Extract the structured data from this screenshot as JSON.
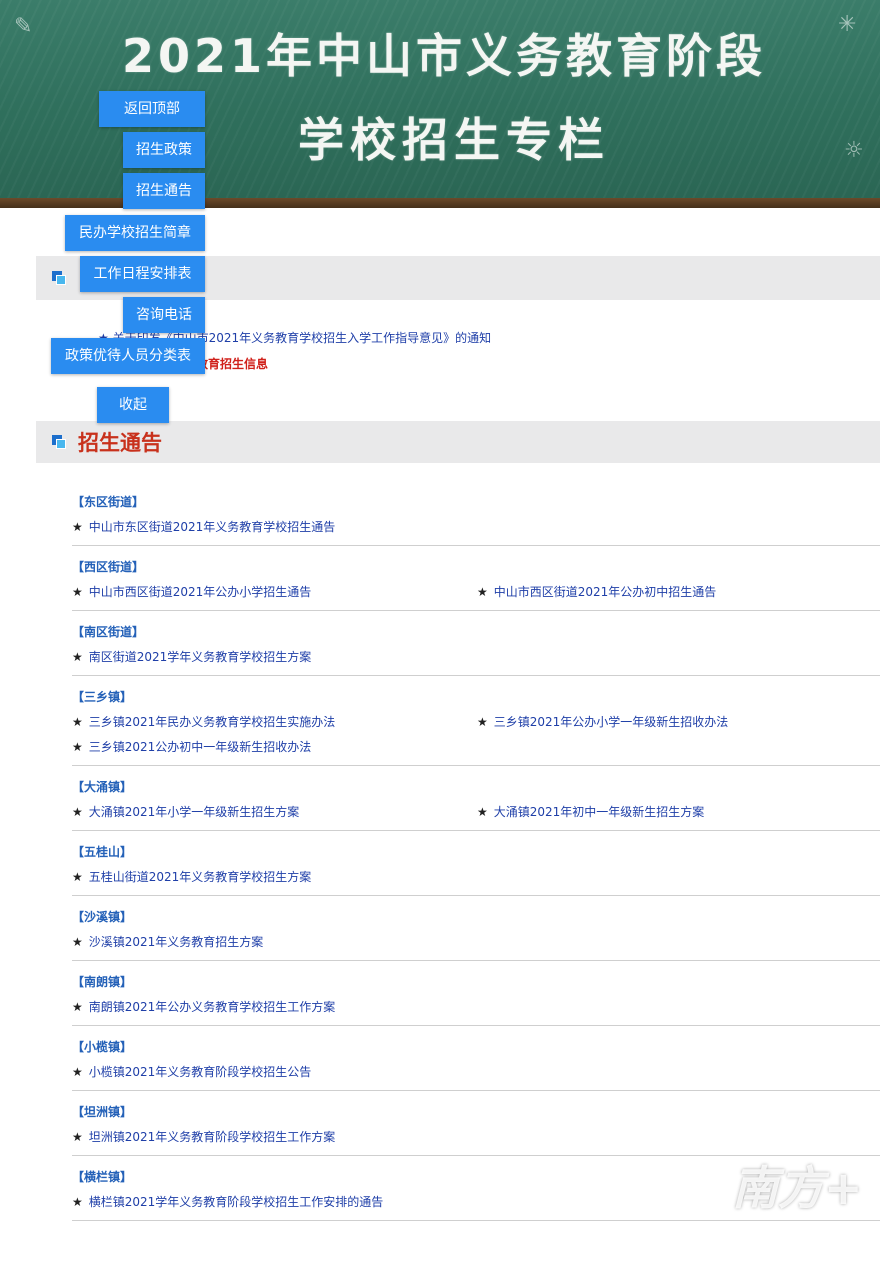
{
  "banner": {
    "title_line1": "2021年中山市义务教育阶段",
    "title_line2": "学校招生专栏"
  },
  "nav": {
    "back_top": "返回顶部",
    "policy": "招生政策",
    "notice": "招生通告",
    "private_school": "民办学校招生简章",
    "schedule": "工作日程安排表",
    "hotline": "咨询电话",
    "preferential": "政策优待人员分类表",
    "collapse": "收起"
  },
  "policy_section": {
    "items": [
      "★ 关于印发《中山市2021年义务教育学校招生入学工作指导意见》的通知",
      "教育招生信息"
    ]
  },
  "notice_section": {
    "title": "招生通告",
    "groups": [
      {
        "name": "【东区街道】",
        "items": [
          "中山市东区街道2021年义务教育学校招生通告"
        ]
      },
      {
        "name": "【西区街道】",
        "items": [
          "中山市西区街道2021年公办小学招生通告",
          "中山市西区街道2021年公办初中招生通告"
        ]
      },
      {
        "name": "【南区街道】",
        "items": [
          "南区街道2021学年义务教育学校招生方案"
        ]
      },
      {
        "name": "【三乡镇】",
        "items": [
          "三乡镇2021年民办义务教育学校招生实施办法",
          "三乡镇2021年公办小学一年级新生招收办法",
          "三乡镇2021公办初中一年级新生招收办法"
        ]
      },
      {
        "name": "【大涌镇】",
        "items": [
          "大涌镇2021年小学一年级新生招生方案",
          "大涌镇2021年初中一年级新生招生方案"
        ]
      },
      {
        "name": "【五桂山】",
        "items": [
          "五桂山街道2021年义务教育学校招生方案"
        ]
      },
      {
        "name": "【沙溪镇】",
        "items": [
          "沙溪镇2021年义务教育招生方案"
        ]
      },
      {
        "name": "【南朗镇】",
        "items": [
          "南朗镇2021年公办义务教育学校招生工作方案"
        ]
      },
      {
        "name": "【小榄镇】",
        "items": [
          "小榄镇2021年义务教育阶段学校招生公告"
        ]
      },
      {
        "name": "【坦洲镇】",
        "items": [
          "坦洲镇2021年义务教育阶段学校招生工作方案"
        ]
      },
      {
        "name": "【横栏镇】",
        "items": [
          "横栏镇2021学年义务教育阶段学校招生工作安排的通告"
        ]
      }
    ]
  },
  "watermark": {
    "logo": "南方+"
  },
  "colors": {
    "nav_blue": "#2a8cf0",
    "section_red": "#c8311c",
    "link_blue": "#1f3fa8",
    "chalkboard": "#2f6f5c"
  }
}
